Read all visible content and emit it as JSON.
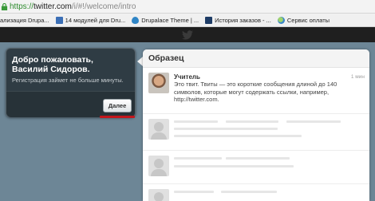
{
  "browser": {
    "url_prefix": "https://",
    "url_host": "twitter.com",
    "url_path": "/i/#!/welcome/intro"
  },
  "bookmarks": [
    {
      "label": "ализация Drupa...",
      "icon": "drupal-icon"
    },
    {
      "label": "14 модулей для Dru...",
      "icon": "page-icon"
    },
    {
      "label": "Drupalace Theme | ...",
      "icon": "drupal-icon"
    },
    {
      "label": "История заказов - ...",
      "icon": "page-icon"
    },
    {
      "label": "Сервис оплаты",
      "icon": "globe-icon"
    }
  ],
  "welcome": {
    "title": "Добро пожаловать, Василий Сидоров.",
    "subtitle": "Регистрация займет не больше минуты.",
    "next_label": "Далее"
  },
  "sample": {
    "title": "Образец",
    "tweet": {
      "name": "Учитель",
      "time": "1 мин",
      "text": "Это твит. Твиты — это короткие сообщения длиной до 140 символов, которые могут содержать ссылки, например, http://twitter.com."
    }
  },
  "colors": {
    "accent": "#c3161c",
    "secure": "#2c8a2c",
    "dark_bar": "#1f1f1f"
  }
}
